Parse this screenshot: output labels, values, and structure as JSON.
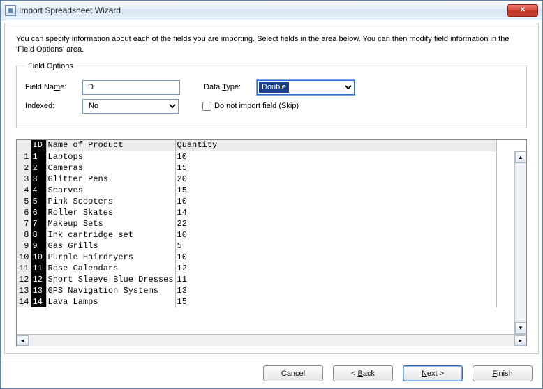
{
  "window": {
    "title": "Import Spreadsheet Wizard"
  },
  "intro": "You can specify information about each of the fields you are importing. Select fields in the area below. You can then modify field information in the 'Field Options' area.",
  "field_options": {
    "legend": "Field Options",
    "field_name_label": "Field Name:",
    "field_name_value": "ID",
    "data_type_label": "Data Type:",
    "data_type_value": "Double",
    "indexed_label": "Indexed:",
    "indexed_value": "No",
    "skip_label": "Do not import field (Skip)",
    "skip_checked": false
  },
  "grid": {
    "columns": [
      "ID",
      "Name of Product",
      "Quantity"
    ],
    "rows": [
      {
        "n": 1,
        "id": "1",
        "name": "Laptops",
        "qty": "10"
      },
      {
        "n": 2,
        "id": "2",
        "name": "Cameras",
        "qty": "15"
      },
      {
        "n": 3,
        "id": "3",
        "name": "Glitter Pens",
        "qty": "20"
      },
      {
        "n": 4,
        "id": "4",
        "name": "Scarves",
        "qty": "15"
      },
      {
        "n": 5,
        "id": "5",
        "name": "Pink Scooters",
        "qty": "10"
      },
      {
        "n": 6,
        "id": "6",
        "name": "Roller Skates",
        "qty": "14"
      },
      {
        "n": 7,
        "id": "7",
        "name": "Makeup Sets",
        "qty": "22"
      },
      {
        "n": 8,
        "id": "8",
        "name": "Ink cartridge set",
        "qty": "10"
      },
      {
        "n": 9,
        "id": "9",
        "name": "Gas Grills",
        "qty": "5"
      },
      {
        "n": 10,
        "id": "10",
        "name": "Purple Hairdryers",
        "qty": "10"
      },
      {
        "n": 11,
        "id": "11",
        "name": "Rose Calendars",
        "qty": "12"
      },
      {
        "n": 12,
        "id": "12",
        "name": "Short Sleeve Blue Dresses",
        "qty": "11"
      },
      {
        "n": 13,
        "id": "13",
        "name": "GPS Navigation Systems",
        "qty": "13"
      },
      {
        "n": 14,
        "id": "14",
        "name": "Lava Lamps",
        "qty": "15"
      }
    ]
  },
  "buttons": {
    "cancel": "Cancel",
    "back": "< Back",
    "next": "Next >",
    "finish": "Finish"
  }
}
